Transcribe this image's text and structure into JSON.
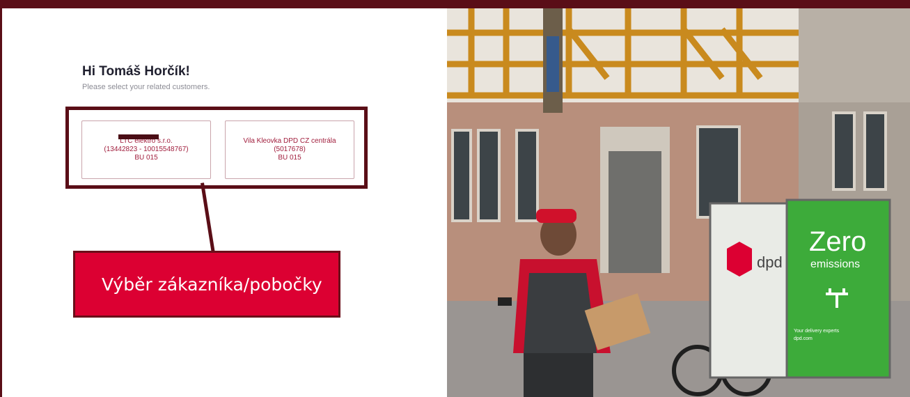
{
  "header": {
    "greeting": "Hi Tomáš Horčík!",
    "subtitle": "Please select your related customers."
  },
  "customers": [
    {
      "name": "LTC elektro s.r.o.",
      "ids": "(13442823 - 10015548767)",
      "bu": "BU 015"
    },
    {
      "name": "Vila Kleovka DPD CZ centrála",
      "ids": "(5017678)",
      "bu": "BU 015"
    }
  ],
  "annotation": {
    "label": "Výběr zákazníka/pobočky"
  },
  "photo": {
    "cargo_brand": "dpd",
    "cargo_headline": "Zero",
    "cargo_subline": "emissions",
    "cargo_tagline": "Your delivery experts",
    "cargo_url": "dpd.com"
  },
  "colors": {
    "frame": "#5a0e17",
    "accent": "#dc0032",
    "card_text": "#a01d3c",
    "cargo_green": "#3dab3a"
  }
}
